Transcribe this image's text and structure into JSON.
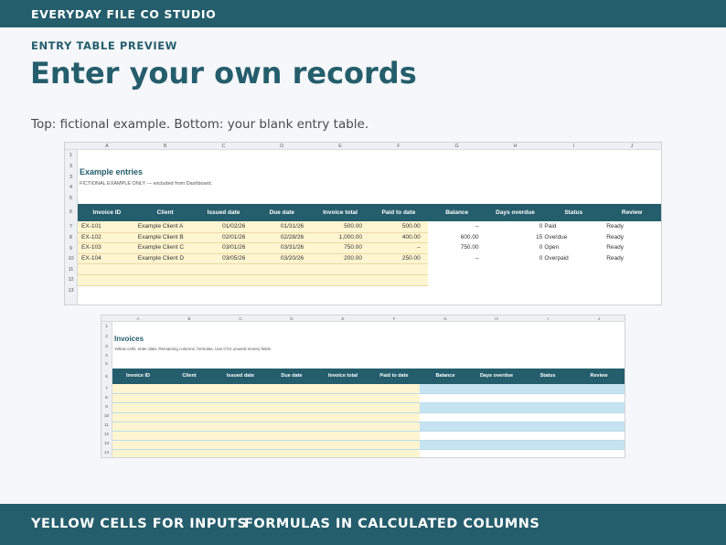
{
  "brand": "EVERYDAY FILE CO STUDIO",
  "eyebrow": "ENTRY TABLE PREVIEW",
  "headline": "Enter your own records",
  "subtitle": "Top: fictional example. Bottom: your blank entry table.",
  "columns": [
    "A",
    "B",
    "C",
    "D",
    "E",
    "F",
    "G",
    "H",
    "I",
    "J"
  ],
  "headers": [
    "Invoice ID",
    "Client",
    "Issued date",
    "Due date",
    "Invoice total",
    "Paid to date",
    "Balance",
    "Days overdue",
    "Status",
    "Review"
  ],
  "example": {
    "title": "Example entries",
    "note": "FICTIONAL EXAMPLE ONLY — excluded from Dashboard.",
    "row_numbers": [
      "1",
      "3",
      "3",
      "4",
      "5",
      "6",
      "7",
      "8",
      "9",
      "10",
      "11",
      "12",
      "13"
    ],
    "rows": [
      [
        "EX-101",
        "Example Client A",
        "01/02/26",
        "01/31/26",
        "500.00",
        "500.00",
        "–",
        "0",
        "Paid",
        "Ready"
      ],
      [
        "EX-102",
        "Example Client B",
        "02/01/26",
        "02/28/26",
        "1,000.00",
        "400.00",
        "600.00",
        "15",
        "Overdue",
        "Ready"
      ],
      [
        "EX-103",
        "Example Client C",
        "03/01/26",
        "03/31/26",
        "750.00",
        "–",
        "750.00",
        "0",
        "Open",
        "Ready"
      ],
      [
        "EX-104",
        "Example Client D",
        "03/05/26",
        "03/20/26",
        "200.00",
        "250.00",
        "–",
        "0",
        "Overpaid",
        "Ready"
      ]
    ]
  },
  "entry": {
    "title": "Invoices",
    "note": "Yellow cells: enter data. Remaining columns: formulas. Use 0 for unused money fields.",
    "row_numbers": [
      "1",
      "2",
      "3",
      "4",
      "5",
      "6",
      "7",
      "8",
      "9",
      "10",
      "11",
      "12",
      "13",
      "14"
    ]
  },
  "footer": {
    "left": "YELLOW CELLS FOR INPUTS",
    "right": "FORMULAS IN CALCULATED COLUMNS"
  }
}
